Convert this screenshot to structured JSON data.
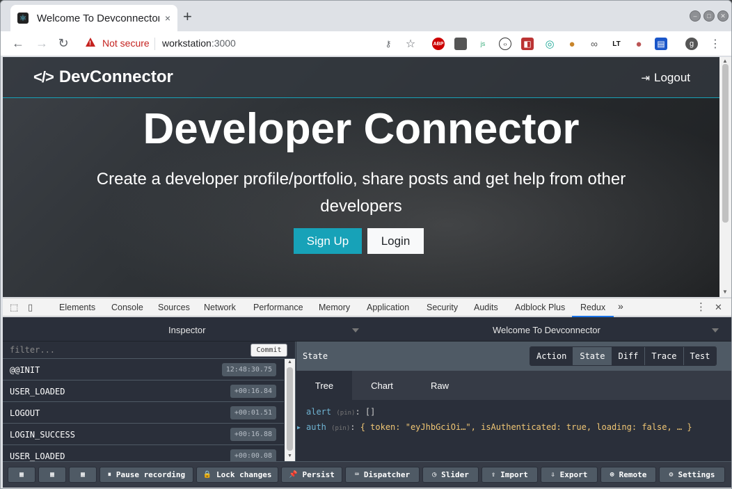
{
  "browser": {
    "tab_title": "Welcome To Devconnector",
    "tab_close": "×",
    "new_tab": "+",
    "security_label": "Not secure",
    "url_host": "workstation",
    "url_port": ":3000",
    "profile_initial": "g"
  },
  "site": {
    "brand": "DevConnector",
    "brand_icon": "</>",
    "logout_label": "Logout",
    "hero_title": "Developer Connector",
    "hero_lead": "Create a developer profile/portfolio, share posts and get help from other developers",
    "signup_label": "Sign Up",
    "login_label": "Login",
    "colors": {
      "accent": "#17a2b8"
    }
  },
  "devtools": {
    "tabs": [
      "Elements",
      "Console",
      "Sources",
      "Network",
      "Performance",
      "Memory",
      "Application",
      "Security",
      "Audits",
      "Adblock Plus",
      "Redux"
    ],
    "active_tab": "Redux",
    "more": "»"
  },
  "redux": {
    "monitor": "Inspector",
    "instance": "Welcome To Devconnector",
    "filter_placeholder": "filter...",
    "commit_label": "Commit",
    "actions": [
      {
        "name": "@@INIT",
        "time": "12:48:30.75"
      },
      {
        "name": "USER_LOADED",
        "time": "+00:16.84"
      },
      {
        "name": "LOGOUT",
        "time": "+00:01.51"
      },
      {
        "name": "LOGIN_SUCCESS",
        "time": "+00:16.88"
      },
      {
        "name": "USER_LOADED",
        "time": "+00:00.08"
      }
    ],
    "pane_title": "State",
    "view_buttons": [
      "Action",
      "State",
      "Diff",
      "Trace",
      "Test"
    ],
    "active_view": "State",
    "subtabs": [
      "Tree",
      "Chart",
      "Raw"
    ],
    "active_subtab": "Tree",
    "tree": {
      "alert_key": "alert",
      "alert_pin": "(pin)",
      "alert_value": "[]",
      "auth_key": "auth",
      "auth_pin": "(pin)",
      "auth_open": "{ ",
      "auth_token_key": "token: ",
      "auth_token_val": "\"eyJhbGciOi…\"",
      "auth_isauth_key": ", isAuthenticated: ",
      "auth_isauth_val": "true",
      "auth_loading_key": ", loading: ",
      "auth_loading_val": "false",
      "auth_close": ", … }"
    },
    "bottom_buttons": [
      {
        "label": "",
        "icon": "grid-icon"
      },
      {
        "label": "",
        "icon": "grid-icon"
      },
      {
        "label": "",
        "icon": "grid-icon"
      },
      {
        "label": "Pause recording",
        "icon": "pause-icon"
      },
      {
        "label": "Lock changes",
        "icon": "lock-icon"
      },
      {
        "label": "Persist",
        "icon": "pin-icon"
      },
      {
        "label": "Dispatcher",
        "icon": "keyboard-icon"
      },
      {
        "label": "Slider",
        "icon": "clock-icon"
      },
      {
        "label": "Import",
        "icon": "upload-icon"
      },
      {
        "label": "Export",
        "icon": "download-icon"
      },
      {
        "label": "Remote",
        "icon": "broadcast-icon"
      },
      {
        "label": "Settings",
        "icon": "gear-icon"
      }
    ]
  }
}
